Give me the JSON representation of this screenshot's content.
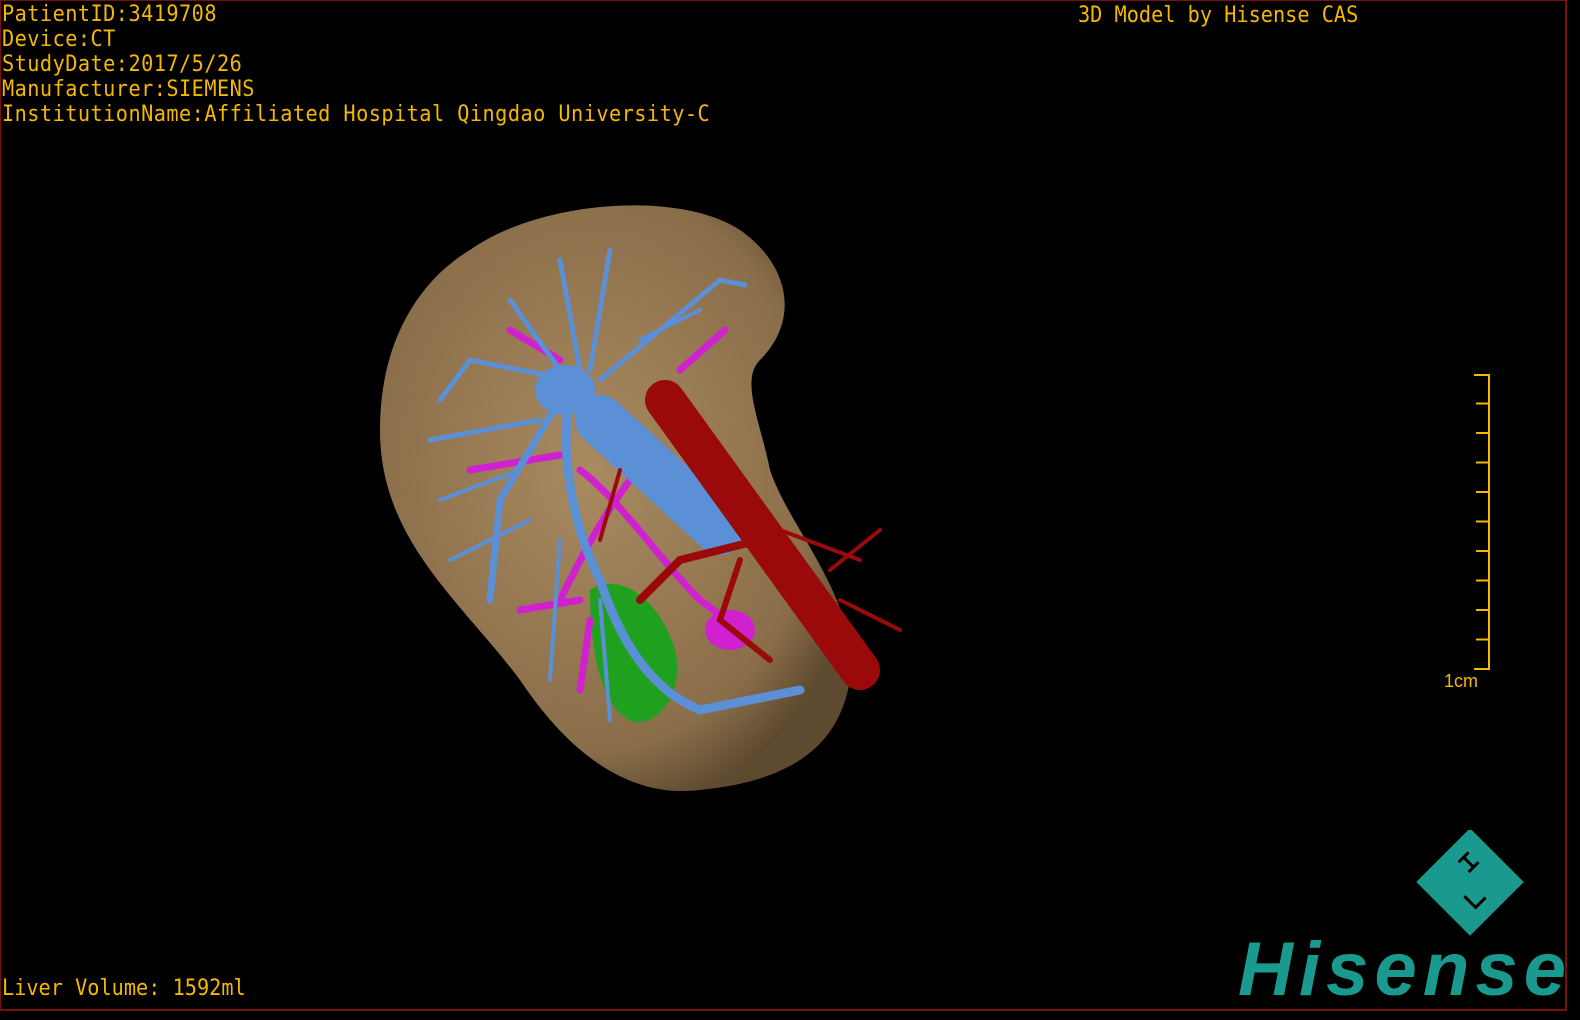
{
  "patient_info": {
    "patient_id": "PatientID:3419708",
    "device": "Device:CT",
    "study_date": "StudyDate:2017/5/26",
    "manufacturer": "Manufacturer:SIEMENS",
    "institution": "InstitutionName:Affiliated Hospital Qingdao University-C"
  },
  "model_credit": "3D Model by Hisense CAS",
  "liver_volume": "Liver Volume: 1592ml",
  "scale_bar": {
    "label": "1cm",
    "ticks": 10
  },
  "logo": {
    "text": "Hisense",
    "color": "#1a9a8e"
  },
  "model_colors": {
    "liver": "#9c7f58",
    "portal_vein": "#5b8fd6",
    "hepatic_vein": "#d020d0",
    "artery": "#9a0a0a",
    "gallbladder": "#1fa01f"
  },
  "text_color": "#f5b800"
}
